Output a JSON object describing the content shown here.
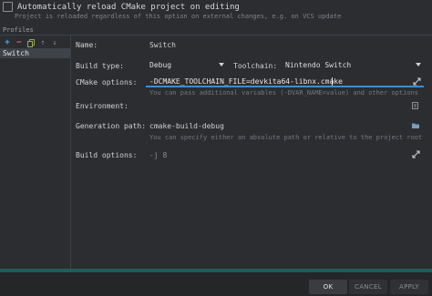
{
  "reload_option": {
    "label": "Automatically reload CMake project on editing",
    "hint": "Project is reloaded regardless of this option on external changes, e.g. on VCS update"
  },
  "profiles": {
    "section_label": "Profiles",
    "items": [
      "Switch"
    ]
  },
  "form": {
    "name_label": "Name:",
    "name_value": "Switch",
    "build_type_label": "Build type:",
    "build_type_value": "Debug",
    "toolchain_label": "Toolchain:",
    "toolchain_value": "Nintendo Switch",
    "cmake_options_label": "CMake options:",
    "cmake_options_value": "-DCMAKE_TOOLCHAIN_FILE=devkita64-libnx.cmake",
    "cmake_options_hint": "You can pass additional variables (-DVAR_NAME=value) and other options",
    "environment_label": "Environment:",
    "generation_path_label": "Generation path:",
    "generation_path_value": "cmake-build-debug",
    "generation_path_hint": "You can specify either an absolute path or relative to the project root",
    "build_options_label": "Build options:",
    "build_options_value": "-j 8"
  },
  "buttons": {
    "ok": "OK",
    "cancel": "CANCEL",
    "apply": "APPLY"
  }
}
